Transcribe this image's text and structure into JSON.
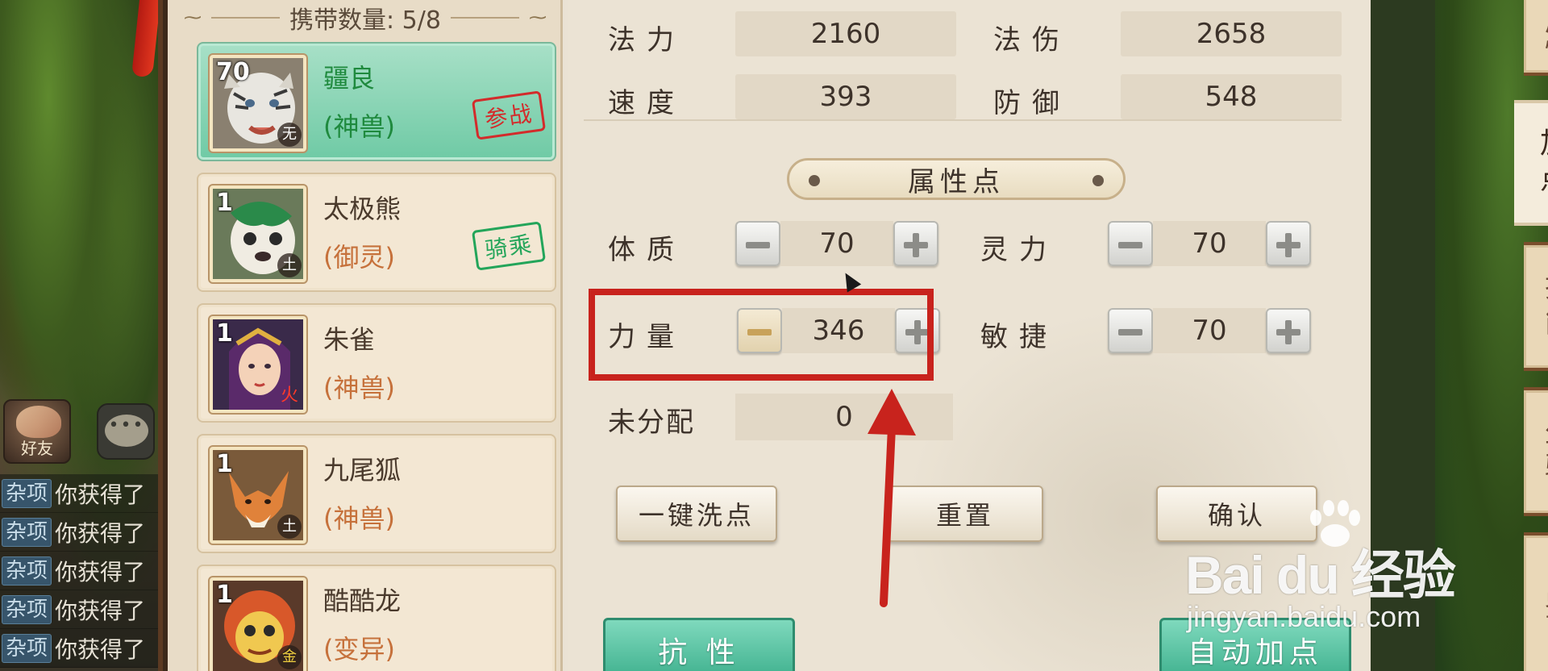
{
  "carry": {
    "label": "携带数量: 5/8"
  },
  "pets": [
    {
      "name": "疆良",
      "type": "(神兽)",
      "level": "70",
      "element": "无",
      "stamp": "参战",
      "stamp_color": "#d32b2b"
    },
    {
      "name": "太极熊",
      "type": "(御灵)",
      "level": "1",
      "element": "土",
      "stamp": "骑乘",
      "stamp_color": "#23a55a"
    },
    {
      "name": "朱雀",
      "type": "(神兽)",
      "level": "1",
      "element": "火",
      "stamp": ""
    },
    {
      "name": "九尾狐",
      "type": "(神兽)",
      "level": "1",
      "element": "土",
      "stamp": ""
    },
    {
      "name": "酷酷龙",
      "type": "(变异)",
      "level": "1",
      "element": "金",
      "stamp": ""
    }
  ],
  "stats": {
    "mana": {
      "label": "法力",
      "value": "2160"
    },
    "magic_damage": {
      "label": "法伤",
      "value": "2658"
    },
    "speed": {
      "label": "速度",
      "value": "393"
    },
    "defense": {
      "label": "防御",
      "value": "548"
    }
  },
  "attribute_points": {
    "title": "属性点",
    "constitution": {
      "label": "体质",
      "value": "70"
    },
    "spirit": {
      "label": "灵力",
      "value": "70"
    },
    "strength": {
      "label": "力量",
      "value": "346"
    },
    "agility": {
      "label": "敏捷",
      "value": "70"
    },
    "unallocated": {
      "label": "未分配",
      "value": "0"
    }
  },
  "buttons": {
    "wash_points": "一键洗点",
    "reset": "重置",
    "confirm": "确认",
    "resistance": "抗 性",
    "auto_add": "自动加点"
  },
  "tabs": {
    "attributes": "属性",
    "add_points": "加点",
    "skills": "技能",
    "mount": "坐骑",
    "extra": "鉴"
  },
  "chat": {
    "friend_label": "好友",
    "bubble": "•••",
    "lines": [
      {
        "tag": "杂项",
        "text": "你获得了"
      },
      {
        "tag": "杂项",
        "text": "你获得了"
      },
      {
        "tag": "杂项",
        "text": "你获得了"
      },
      {
        "tag": "杂项",
        "text": "你获得了"
      },
      {
        "tag": "杂项",
        "text": "你获得了"
      }
    ]
  },
  "watermark": {
    "main": "Bai du 经验",
    "sub": "jingyan.baidu.com"
  },
  "colors": {
    "highlight": "#c8231d",
    "active_card": "#6fcaa5",
    "teal_button": "#3eb08d"
  }
}
